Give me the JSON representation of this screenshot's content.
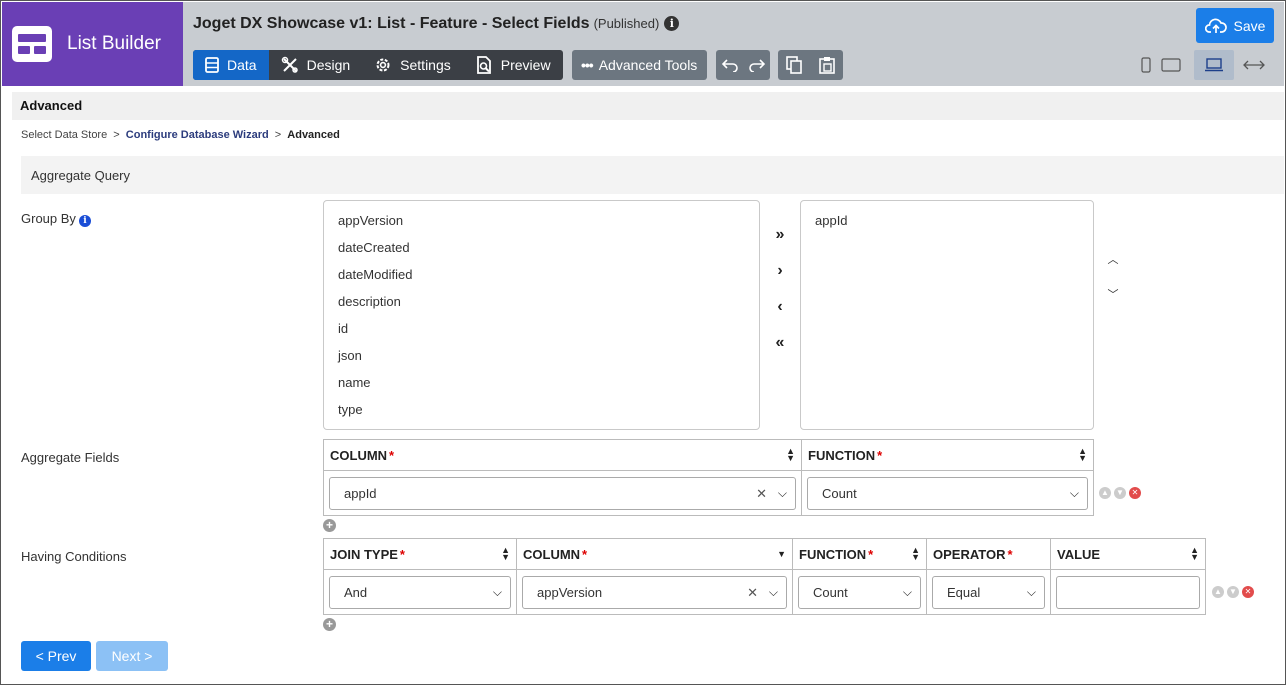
{
  "brand": {
    "title": "List Builder"
  },
  "header": {
    "title": "Joget DX Showcase v1: List - Feature - Select Fields",
    "status": "(Published)",
    "tabs": [
      {
        "label": "Data",
        "icon": "table-icon",
        "active": true
      },
      {
        "label": "Design",
        "icon": "design-tools-icon"
      },
      {
        "label": "Settings",
        "icon": "gear-icon"
      },
      {
        "label": "Preview",
        "icon": "preview-icon"
      }
    ],
    "advanced_tools": "Advanced Tools",
    "save": "Save"
  },
  "section": {
    "title": "Advanced"
  },
  "breadcrumb": {
    "step1": "Select Data Store",
    "sep": ">",
    "step2": "Configure Database Wizard",
    "step3": "Advanced"
  },
  "aggregate": {
    "title": "Aggregate Query",
    "group_by_label": "Group By",
    "available_fields": [
      "appVersion",
      "dateCreated",
      "dateModified",
      "description",
      "id",
      "json",
      "name",
      "type"
    ],
    "selected_fields": [
      "appId"
    ],
    "aggregate_fields_label": "Aggregate Fields",
    "agg_headers": {
      "column": "COLUMN",
      "function": "FUNCTION"
    },
    "agg_row": {
      "column": "appId",
      "function": "Count"
    },
    "having_label": "Having Conditions",
    "having_headers": {
      "join": "JOIN TYPE",
      "column": "COLUMN",
      "function": "FUNCTION",
      "operator": "OPERATOR",
      "value": "VALUE"
    },
    "having_row": {
      "join": "And",
      "column": "appVersion",
      "function": "Count",
      "operator": "Equal",
      "value": ""
    },
    "required_mark": "*"
  },
  "nav": {
    "prev": "< Prev",
    "next": "Next >"
  },
  "colors": {
    "brand": "#6a3fb5",
    "primary": "#1b7ee8",
    "tab_active": "#1467c7",
    "disabled": "#8cc1f5"
  }
}
